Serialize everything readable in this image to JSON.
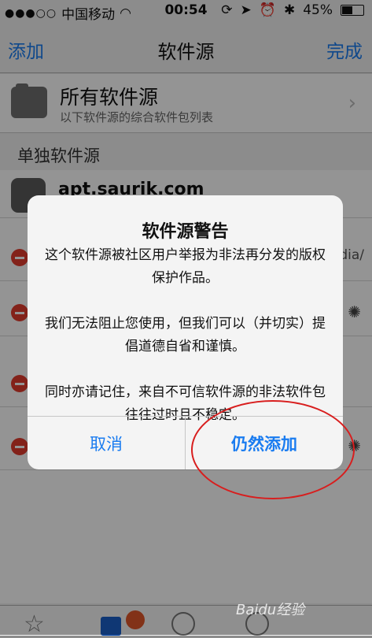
{
  "status_bar": {
    "carrier": "中国移动",
    "time": "00:54",
    "battery": "45%",
    "battery_level": 0.45
  },
  "nav": {
    "left": "添加",
    "title": "软件源",
    "right": "完成"
  },
  "all_sources": {
    "title": "所有软件源",
    "subtitle": "以下软件源的综合软件包列表"
  },
  "section": {
    "title": "单独软件源"
  },
  "sources": [
    {
      "title": "apt.saurik.com",
      "trailing": ""
    },
    {
      "title": "",
      "trailing": "ydia/"
    },
    {
      "title": "",
      "trailing": ""
    },
    {
      "title": "",
      "trailing": ""
    },
    {
      "title": "",
      "trailing": ""
    }
  ],
  "alert": {
    "title": "软件源警告",
    "paragraph1": "这个软件源被社区用户举报为非法再分发的版权保护作品。",
    "paragraph2": "我们无法阻止您使用，但我们可以（并切实）提倡道德自省和谨慎。",
    "paragraph3": "同时亦请记住，来自不可信软件源的非法软件包往往过时且不稳定。",
    "cancel": "取消",
    "confirm": "仍然添加"
  },
  "watermark": "Baidu经验",
  "colors": {
    "accent": "#1a7cf0",
    "destructive": "#e23b2e",
    "annotation": "#d81e1e"
  }
}
